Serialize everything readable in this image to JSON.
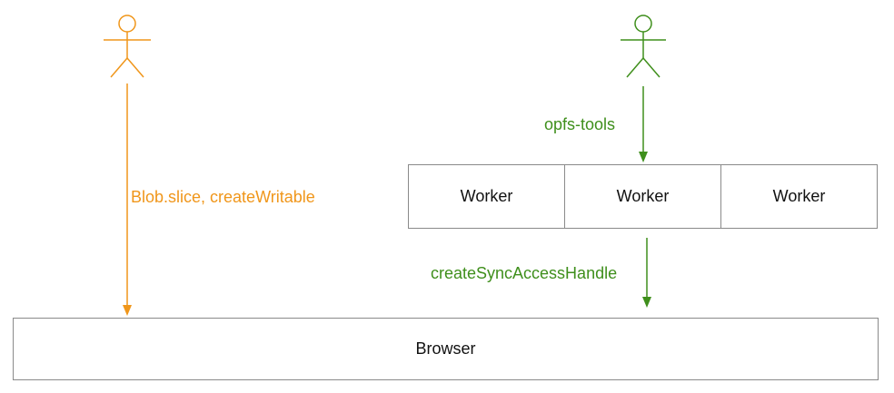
{
  "actors": [
    {
      "id": "actor-left",
      "color": "#f0961a"
    },
    {
      "id": "actor-right",
      "color": "#3f8f1c"
    }
  ],
  "edges": {
    "blob_label": "Blob.slice, createWritable",
    "opfs_label": "opfs-tools",
    "sync_label": "createSyncAccessHandle"
  },
  "workers": [
    "Worker",
    "Worker",
    "Worker"
  ],
  "browser": {
    "label": "Browser"
  },
  "colors": {
    "orange": "#f0961a",
    "green": "#3f8f1c",
    "border": "#8a8a8a"
  }
}
